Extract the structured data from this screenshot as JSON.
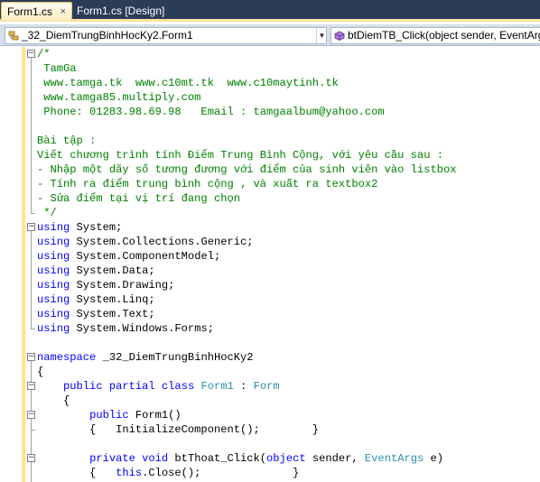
{
  "tabs": [
    {
      "label": "Form1.cs",
      "active": true
    },
    {
      "label": "Form1.cs [Design]",
      "active": false
    }
  ],
  "tab_close_glyph": "×",
  "nav": {
    "type_combo": "_32_DiemTrungBinhHocKy2.Form1",
    "member_combo": "btDiemTB_Click(object sender, EventArgs e)",
    "dropdown_glyph": "▼"
  },
  "colors": {
    "keyword": "#0000ff",
    "comment": "#008000",
    "type": "#2b91af",
    "text": "#000000",
    "tab_strip": "#2b3c59",
    "change_margin": "#fde58a"
  },
  "icons": {
    "class_icon": "class-icon",
    "method_icon": "method-icon",
    "close_icon": "close-icon"
  },
  "code_lines": [
    {
      "fold": "minus",
      "tokens": [
        {
          "t": "/*",
          "c": "cm"
        }
      ]
    },
    {
      "tokens": [
        {
          "t": " TamGa",
          "c": "cm"
        }
      ]
    },
    {
      "tokens": [
        {
          "t": " www.tamga.tk  www.c10mt.tk  www.c10maytinh.tk",
          "c": "cm"
        }
      ]
    },
    {
      "tokens": [
        {
          "t": " www.tamga85.multiply.com",
          "c": "cm"
        }
      ]
    },
    {
      "tokens": [
        {
          "t": " Phone: 01283.98.69.98   Email : tamgaalbum@yahoo.com",
          "c": "cm"
        }
      ]
    },
    {
      "tokens": [
        {
          "t": "",
          "c": "cm"
        }
      ]
    },
    {
      "tokens": [
        {
          "t": "Bài tập :",
          "c": "cm"
        }
      ]
    },
    {
      "tokens": [
        {
          "t": "Viết chương trình tính Điểm Trung Bình Cộng, với yêu cầu sau :",
          "c": "cm"
        }
      ]
    },
    {
      "tokens": [
        {
          "t": "- Nhập một dãy số tương đương với điểm của sinh viên vào listbox",
          "c": "cm"
        }
      ]
    },
    {
      "tokens": [
        {
          "t": "- Tính ra điểm trung bình cộng , và xuất ra textbox2",
          "c": "cm"
        }
      ]
    },
    {
      "tokens": [
        {
          "t": "- Sửa điểm tại vị trí đang chọn",
          "c": "cm"
        }
      ]
    },
    {
      "tokens": [
        {
          "t": " */",
          "c": "cm"
        }
      ]
    },
    {
      "fold": "minus",
      "tokens": [
        {
          "t": "using",
          "c": "kw"
        },
        {
          "t": " System;",
          "c": "tx"
        }
      ]
    },
    {
      "tokens": [
        {
          "t": "using",
          "c": "kw"
        },
        {
          "t": " System.Collections.Generic;",
          "c": "tx"
        }
      ]
    },
    {
      "tokens": [
        {
          "t": "using",
          "c": "kw"
        },
        {
          "t": " System.ComponentModel;",
          "c": "tx"
        }
      ]
    },
    {
      "tokens": [
        {
          "t": "using",
          "c": "kw"
        },
        {
          "t": " System.Data;",
          "c": "tx"
        }
      ]
    },
    {
      "tokens": [
        {
          "t": "using",
          "c": "kw"
        },
        {
          "t": " System.Drawing;",
          "c": "tx"
        }
      ]
    },
    {
      "tokens": [
        {
          "t": "using",
          "c": "kw"
        },
        {
          "t": " System.Linq;",
          "c": "tx"
        }
      ]
    },
    {
      "tokens": [
        {
          "t": "using",
          "c": "kw"
        },
        {
          "t": " System.Text;",
          "c": "tx"
        }
      ]
    },
    {
      "tokens": [
        {
          "t": "using",
          "c": "kw"
        },
        {
          "t": " System.Windows.Forms;",
          "c": "tx"
        }
      ]
    },
    {
      "tokens": [
        {
          "t": "",
          "c": "tx"
        }
      ]
    },
    {
      "fold": "minus",
      "tokens": [
        {
          "t": "namespace",
          "c": "kw"
        },
        {
          "t": " _32_DiemTrungBinhHocKy2",
          "c": "tx"
        }
      ]
    },
    {
      "tokens": [
        {
          "t": "{",
          "c": "tx"
        }
      ]
    },
    {
      "fold": "minus",
      "tokens": [
        {
          "t": "    ",
          "c": "tx"
        },
        {
          "t": "public",
          "c": "kw"
        },
        {
          "t": " ",
          "c": "tx"
        },
        {
          "t": "partial",
          "c": "kw"
        },
        {
          "t": " ",
          "c": "tx"
        },
        {
          "t": "class",
          "c": "kw"
        },
        {
          "t": " ",
          "c": "tx"
        },
        {
          "t": "Form1",
          "c": "ty"
        },
        {
          "t": " : ",
          "c": "tx"
        },
        {
          "t": "Form",
          "c": "ty"
        }
      ]
    },
    {
      "tokens": [
        {
          "t": "    {",
          "c": "tx"
        }
      ]
    },
    {
      "fold": "minus",
      "tokens": [
        {
          "t": "        ",
          "c": "tx"
        },
        {
          "t": "public",
          "c": "kw"
        },
        {
          "t": " Form1()",
          "c": "tx"
        }
      ]
    },
    {
      "tokens": [
        {
          "t": "        {   InitializeComponent();        }",
          "c": "tx"
        }
      ]
    },
    {
      "tokens": [
        {
          "t": "",
          "c": "tx"
        }
      ]
    },
    {
      "fold": "minus",
      "tokens": [
        {
          "t": "        ",
          "c": "tx"
        },
        {
          "t": "private",
          "c": "kw"
        },
        {
          "t": " ",
          "c": "tx"
        },
        {
          "t": "void",
          "c": "kw"
        },
        {
          "t": " btThoat_Click(",
          "c": "tx"
        },
        {
          "t": "object",
          "c": "kw"
        },
        {
          "t": " sender, ",
          "c": "tx"
        },
        {
          "t": "EventArgs",
          "c": "ty"
        },
        {
          "t": " e)",
          "c": "tx"
        }
      ]
    },
    {
      "tokens": [
        {
          "t": "        {   ",
          "c": "tx"
        },
        {
          "t": "this",
          "c": "kw"
        },
        {
          "t": ".Close();              }",
          "c": "tx"
        }
      ]
    }
  ]
}
